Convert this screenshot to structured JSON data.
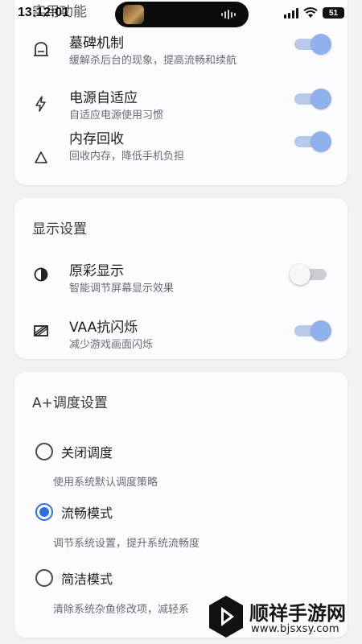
{
  "status_bar": {
    "time": "13:12:01",
    "battery": "51"
  },
  "top_card": {
    "partial_title": "实用功能",
    "items": [
      {
        "title": "墓碑机制",
        "subtitle": "缓解杀后台的现象，提高流畅和续航",
        "icon": "tombstone-icon",
        "on": true
      },
      {
        "title": "电源自适应",
        "subtitle": "自适应电源使用习惯",
        "icon": "lightning-icon",
        "on": true
      },
      {
        "title": "内存回收",
        "subtitle": "回收内存，降低手机负担",
        "icon": "recycle-icon",
        "on": true
      }
    ]
  },
  "display_card": {
    "title": "显示设置",
    "items": [
      {
        "title": "原彩显示",
        "subtitle": "智能调节屏幕显示效果",
        "icon": "contrast-icon",
        "on": false
      },
      {
        "title": "VAA抗闪烁",
        "subtitle": "减少游戏画面闪烁",
        "icon": "anti-flicker-icon",
        "on": true
      }
    ]
  },
  "schedule_card": {
    "title": "A+调度设置",
    "options": [
      {
        "label": "关闭调度",
        "subtitle": "使用系统默认调度策略",
        "checked": false
      },
      {
        "label": "流畅模式",
        "subtitle": "调节系统设置，提升系统流畅度",
        "checked": true
      },
      {
        "label": "简洁模式",
        "subtitle": "清除系统杂鱼修改项，减轻系",
        "checked": false
      }
    ]
  },
  "watermark": {
    "name": "顺祥手游网",
    "url": "www.bjsxsy.com"
  },
  "colors": {
    "accent": "#2f6fe0",
    "toggle_on": "#8fb1ee",
    "background": "#f4f1f6"
  }
}
